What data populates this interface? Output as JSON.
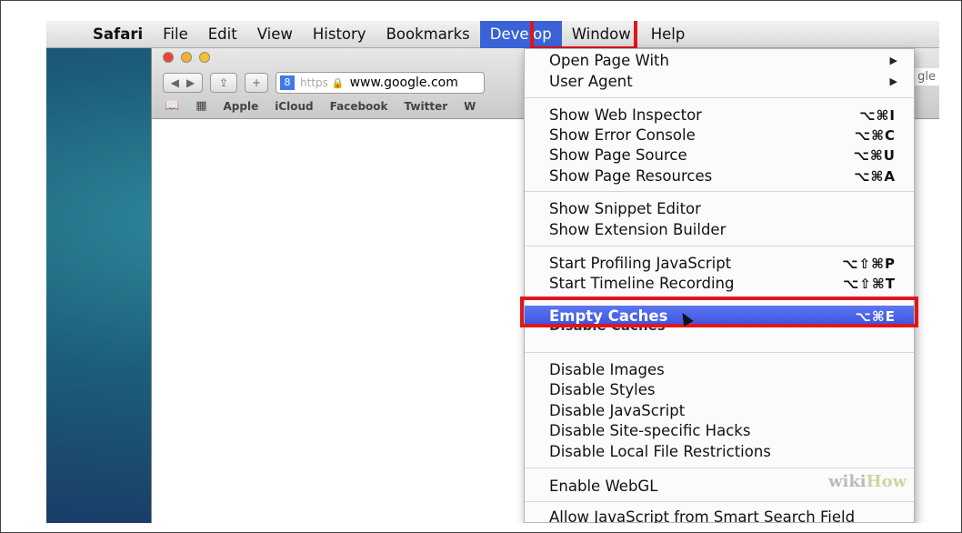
{
  "menubar": {
    "apple": "",
    "items": [
      "Safari",
      "File",
      "Edit",
      "View",
      "History",
      "Bookmarks",
      "Develop",
      "Window",
      "Help"
    ]
  },
  "browser": {
    "nav_back": "◀",
    "nav_forward": "▶",
    "share": "⇪",
    "plus": "+",
    "google_badge": "8",
    "https_label": "https",
    "url": "www.google.com",
    "favorites": [
      "Apple",
      "iCloud",
      "Facebook",
      "Twitter",
      "W"
    ],
    "right_hint": "gle"
  },
  "develop_menu": {
    "open_page_with": "Open Page With",
    "user_agent": "User Agent",
    "show_web_inspector": "Show Web Inspector",
    "show_web_inspector_sc": "⌥⌘I",
    "show_error_console": "Show Error Console",
    "show_error_console_sc": "⌥⌘C",
    "show_page_source": "Show Page Source",
    "show_page_source_sc": "⌥⌘U",
    "show_page_resources": "Show Page Resources",
    "show_page_resources_sc": "⌥⌘A",
    "show_snippet_editor": "Show Snippet Editor",
    "show_extension_builder": "Show Extension Builder",
    "start_profiling_js": "Start Profiling JavaScript",
    "start_profiling_js_sc": "⌥⇧⌘P",
    "start_timeline": "Start Timeline Recording",
    "start_timeline_sc": "⌥⇧⌘T",
    "empty_caches": "Empty Caches",
    "empty_caches_sc": "⌥⌘E",
    "disable_caches": "Disable Caches",
    "disable_images": "Disable Images",
    "disable_styles": "Disable Styles",
    "disable_javascript": "Disable JavaScript",
    "disable_site_hacks": "Disable Site-specific Hacks",
    "disable_local_file": "Disable Local File Restrictions",
    "enable_webgl": "Enable WebGL",
    "allow_js_smart_search": "Allow JavaScript from Smart Search Field"
  },
  "watermark": {
    "wiki": "wiki",
    "how": "How"
  },
  "colors": {
    "highlight": "#3a4fe0",
    "annotation_red": "#e0161b",
    "menubar_active": "#3a63d8"
  }
}
